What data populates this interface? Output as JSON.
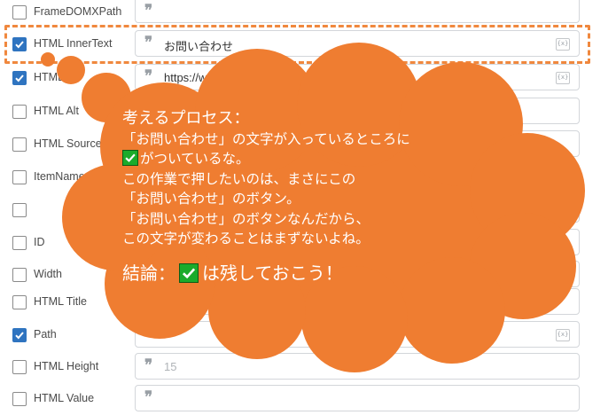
{
  "fields": [
    {
      "label": "FrameDOMXPath",
      "checked": false,
      "value": "",
      "placeholder": ""
    },
    {
      "label": "HTML InnerText",
      "checked": true,
      "value": "お問い合わせ",
      "placeholder": ""
    },
    {
      "label": "HTML",
      "checked": true,
      "value": "https://www.automationanywhere.com/contact",
      "placeholder": ""
    },
    {
      "label": "HTML Alt",
      "checked": false,
      "value": "",
      "placeholder": ""
    },
    {
      "label": "HTML Source",
      "checked": false,
      "value": "",
      "placeholder": ""
    },
    {
      "label": "ItemName",
      "checked": false,
      "value": "",
      "placeholder": ""
    },
    {
      "label": "",
      "checked": false,
      "value": "",
      "placeholder": ""
    },
    {
      "label": "ID",
      "checked": false,
      "value": "",
      "placeholder": ""
    },
    {
      "label": "Width",
      "checked": false,
      "value": "",
      "placeholder": ""
    },
    {
      "label": "HTML Title",
      "checked": false,
      "value": "",
      "placeholder": ""
    },
    {
      "label": "Path",
      "checked": true,
      "value": "",
      "placeholder": ""
    },
    {
      "label": "HTML Height",
      "checked": false,
      "value": "",
      "placeholder": "15"
    },
    {
      "label": "HTML Value",
      "checked": false,
      "value": "",
      "placeholder": ""
    }
  ],
  "variable_button_label": "{x}",
  "thought": {
    "title": "考えるプロセス：",
    "line1": "「お問い合わせ」の文字が入っているところに",
    "line2": "がついているな。",
    "line3": "この作業で押したいのは、まさにこの",
    "line4": "「お問い合わせ」のボタン。",
    "line5": "「お問い合わせ」のボタンなんだから、",
    "line6": "この文字が変わることはまずないよね。",
    "conclusion_prefix": "結論：",
    "conclusion_suffix": "は残しておこう！"
  },
  "colors": {
    "bubble": "#ef7d31",
    "highlight": "#f0883e",
    "checkbox_checked": "#2f74c0",
    "check_emoji": "#1bab2b"
  }
}
